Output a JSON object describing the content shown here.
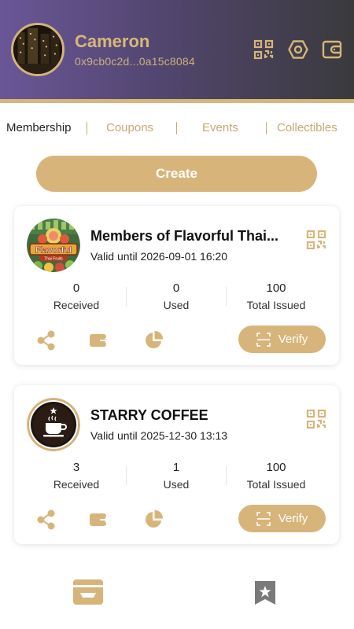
{
  "profile": {
    "name": "Cameron",
    "address": "0x9cb0c2d...0a15c8084"
  },
  "header_icons": [
    "qr-code-icon",
    "settings-icon",
    "wallet-icon"
  ],
  "tabs": [
    {
      "label": "Membership",
      "active": true
    },
    {
      "label": "Coupons",
      "active": false
    },
    {
      "label": "Events",
      "active": false
    },
    {
      "label": "Collectibles",
      "active": false
    }
  ],
  "create_button": {
    "label": "Create"
  },
  "cards": [
    {
      "title": "Members of Flavorful Thai...",
      "valid": "Valid until 2026-09-01 16:20",
      "logo_text": "Flavorful",
      "logo_subtext": "Thai Fruits",
      "stats": [
        {
          "value": "0",
          "label": "Received"
        },
        {
          "value": "0",
          "label": "Used"
        },
        {
          "value": "100",
          "label": "Total Issued"
        }
      ],
      "verify_label": "Verify"
    },
    {
      "title": "STARRY COFFEE",
      "valid": "Valid until 2025-12-30 13:13",
      "stats": [
        {
          "value": "3",
          "label": "Received"
        },
        {
          "value": "1",
          "label": "Used"
        },
        {
          "value": "100",
          "label": "Total Issued"
        }
      ],
      "verify_label": "Verify"
    }
  ],
  "bottom_nav": [
    "cards-icon",
    "bookmark-star-icon"
  ],
  "colors": {
    "accent_gold": "#d7b57a",
    "header_purple": "#6a5698",
    "header_dark": "#3a3a3c",
    "inactive_nav": "#7a7a7a"
  }
}
